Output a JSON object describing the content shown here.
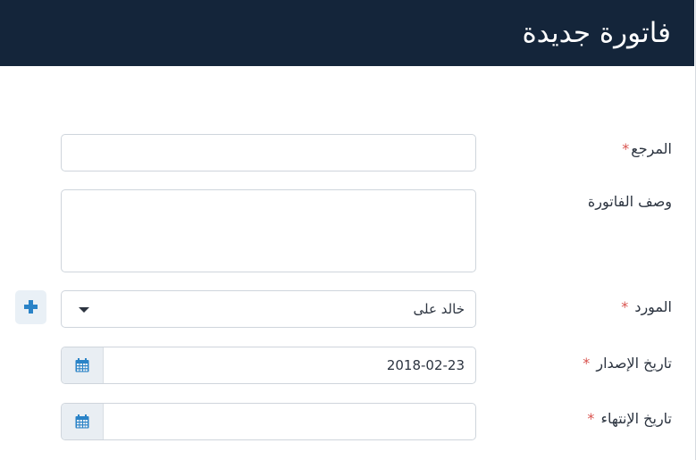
{
  "header": {
    "title": "فاتورة جديدة"
  },
  "form": {
    "reference": {
      "label": "المرجع",
      "required_mark": "*",
      "value": ""
    },
    "description": {
      "label": "وصف الفاتورة",
      "value": ""
    },
    "supplier": {
      "label": "المورد",
      "required_mark": "*",
      "value": "خالد على"
    },
    "issue_date": {
      "label": "تاريخ الإصدار",
      "required_mark": "*",
      "value": "2018-02-23"
    },
    "due_date": {
      "label": "تاريخ الإنتهاء",
      "required_mark": "*",
      "value": ""
    }
  },
  "icons": {
    "add": "plus-icon",
    "calendar": "calendar-icon",
    "dropdown": "chevron-down-icon"
  },
  "colors": {
    "header_bg": "#14253a",
    "required": "#d9534f",
    "accent": "#2a83c7"
  }
}
